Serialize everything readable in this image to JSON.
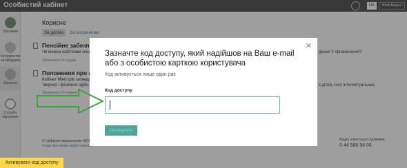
{
  "header": {
    "app_title": "Особистий кабінет",
    "lang": "UA",
    "user_name": "Юлія Бедіна"
  },
  "sidebar": {
    "items": [
      {
        "label": "Про мене",
        "icon": "profile-icon"
      },
      {
        "label": "Інструменти на продукти",
        "icon": "tools-icon"
      },
      {
        "label": "Корисне",
        "icon": "useful-icon"
      },
      {
        "label": "Служба підтримки",
        "icon": "support-icon"
      }
    ]
  },
  "main": {
    "section_title": "Корисне",
    "tabs": [
      "За датою",
      "За виданнями"
    ],
    "docs": [
      {
        "title": "Пенсійне забезпеч",
        "text1": "Чи можна освітянам знижу",
        "text2": "",
        "date": "Збережено 14 грудня"
      },
      {
        "title": "Положення про нау",
        "text1": "Кабінет Міністрів затверд",
        "text2": "творчих і фізичних здібн",
        "date": "Збережено 14 червня"
      }
    ],
    "right_text1": "дення її призначення?",
    "right_text2": "х дітей, гнсх інтелектуальних,",
    "footer_copy": "© Цифрове видавництво МСФ",
    "footer_link": "Угода про умови користування",
    "support_label": "Відділ клієнтської підтримки",
    "support_phone": "0 44 586 56 06"
  },
  "modal": {
    "title": "Зазначте код доступу, який надійшов на Ваш e-mail або з особистою карткою користувача",
    "hint": "Код активується лише один раз",
    "label": "Код доступу",
    "input_value": "",
    "button": "Активувати"
  },
  "bottom_button": "Активувати код доступу",
  "colors": {
    "accent": "#4ea597",
    "arrow": "#3aa33a",
    "highlight": "#ffd74a"
  }
}
